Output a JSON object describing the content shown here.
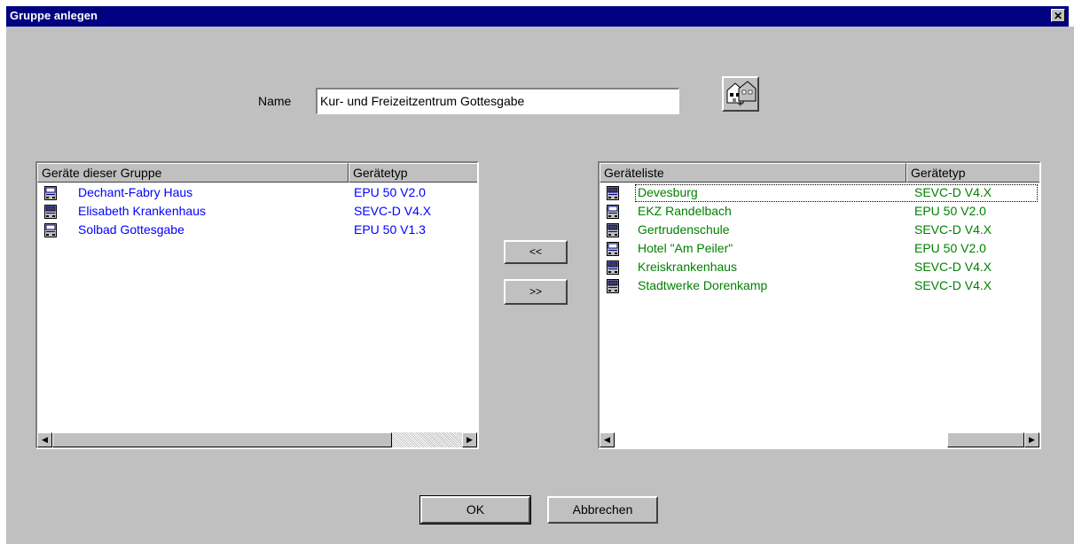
{
  "window": {
    "title": "Gruppe anlegen",
    "close_label": "✕"
  },
  "form": {
    "name_label": "Name",
    "name_value": "Kur- und Freizeitzentrum Gottesgabe"
  },
  "group_list": {
    "col1": "Geräte dieser Gruppe",
    "col2": "Gerätetyp",
    "text_color": "#0000ff",
    "rows": [
      {
        "name": "Dechant-Fabry Haus",
        "type": "EPU 50 V2.0",
        "icon": "epu-device-icon"
      },
      {
        "name": "Elisabeth Krankenhaus",
        "type": "SEVC-D V4.X",
        "icon": "sevc-device-icon"
      },
      {
        "name": "Solbad Gottesgabe",
        "type": "EPU 50 V1.3",
        "icon": "epu-device-icon"
      }
    ]
  },
  "device_list": {
    "col1": "Geräteliste",
    "col2": "Gerätetyp",
    "text_color": "#008000",
    "rows": [
      {
        "name": "Devesburg",
        "type": "SEVC-D V4.X",
        "icon": "sevc-device-icon"
      },
      {
        "name": "EKZ Randelbach",
        "type": "EPU 50 V2.0",
        "icon": "epu-device-icon"
      },
      {
        "name": "Gertrudenschule",
        "type": "SEVC-D V4.X",
        "icon": "sevc-device-icon"
      },
      {
        "name": "Hotel \"Am Peiler\"",
        "type": "EPU 50 V2.0",
        "icon": "epu-device-icon"
      },
      {
        "name": "Kreiskrankenhaus",
        "type": "SEVC-D V4.X",
        "icon": "sevc-device-icon"
      },
      {
        "name": "Stadtwerke Dorenkamp",
        "type": "SEVC-D V4.X",
        "icon": "sevc-device-icon"
      }
    ]
  },
  "buttons": {
    "add": "<<",
    "remove": ">>",
    "ok": "OK",
    "cancel": "Abbrechen"
  }
}
